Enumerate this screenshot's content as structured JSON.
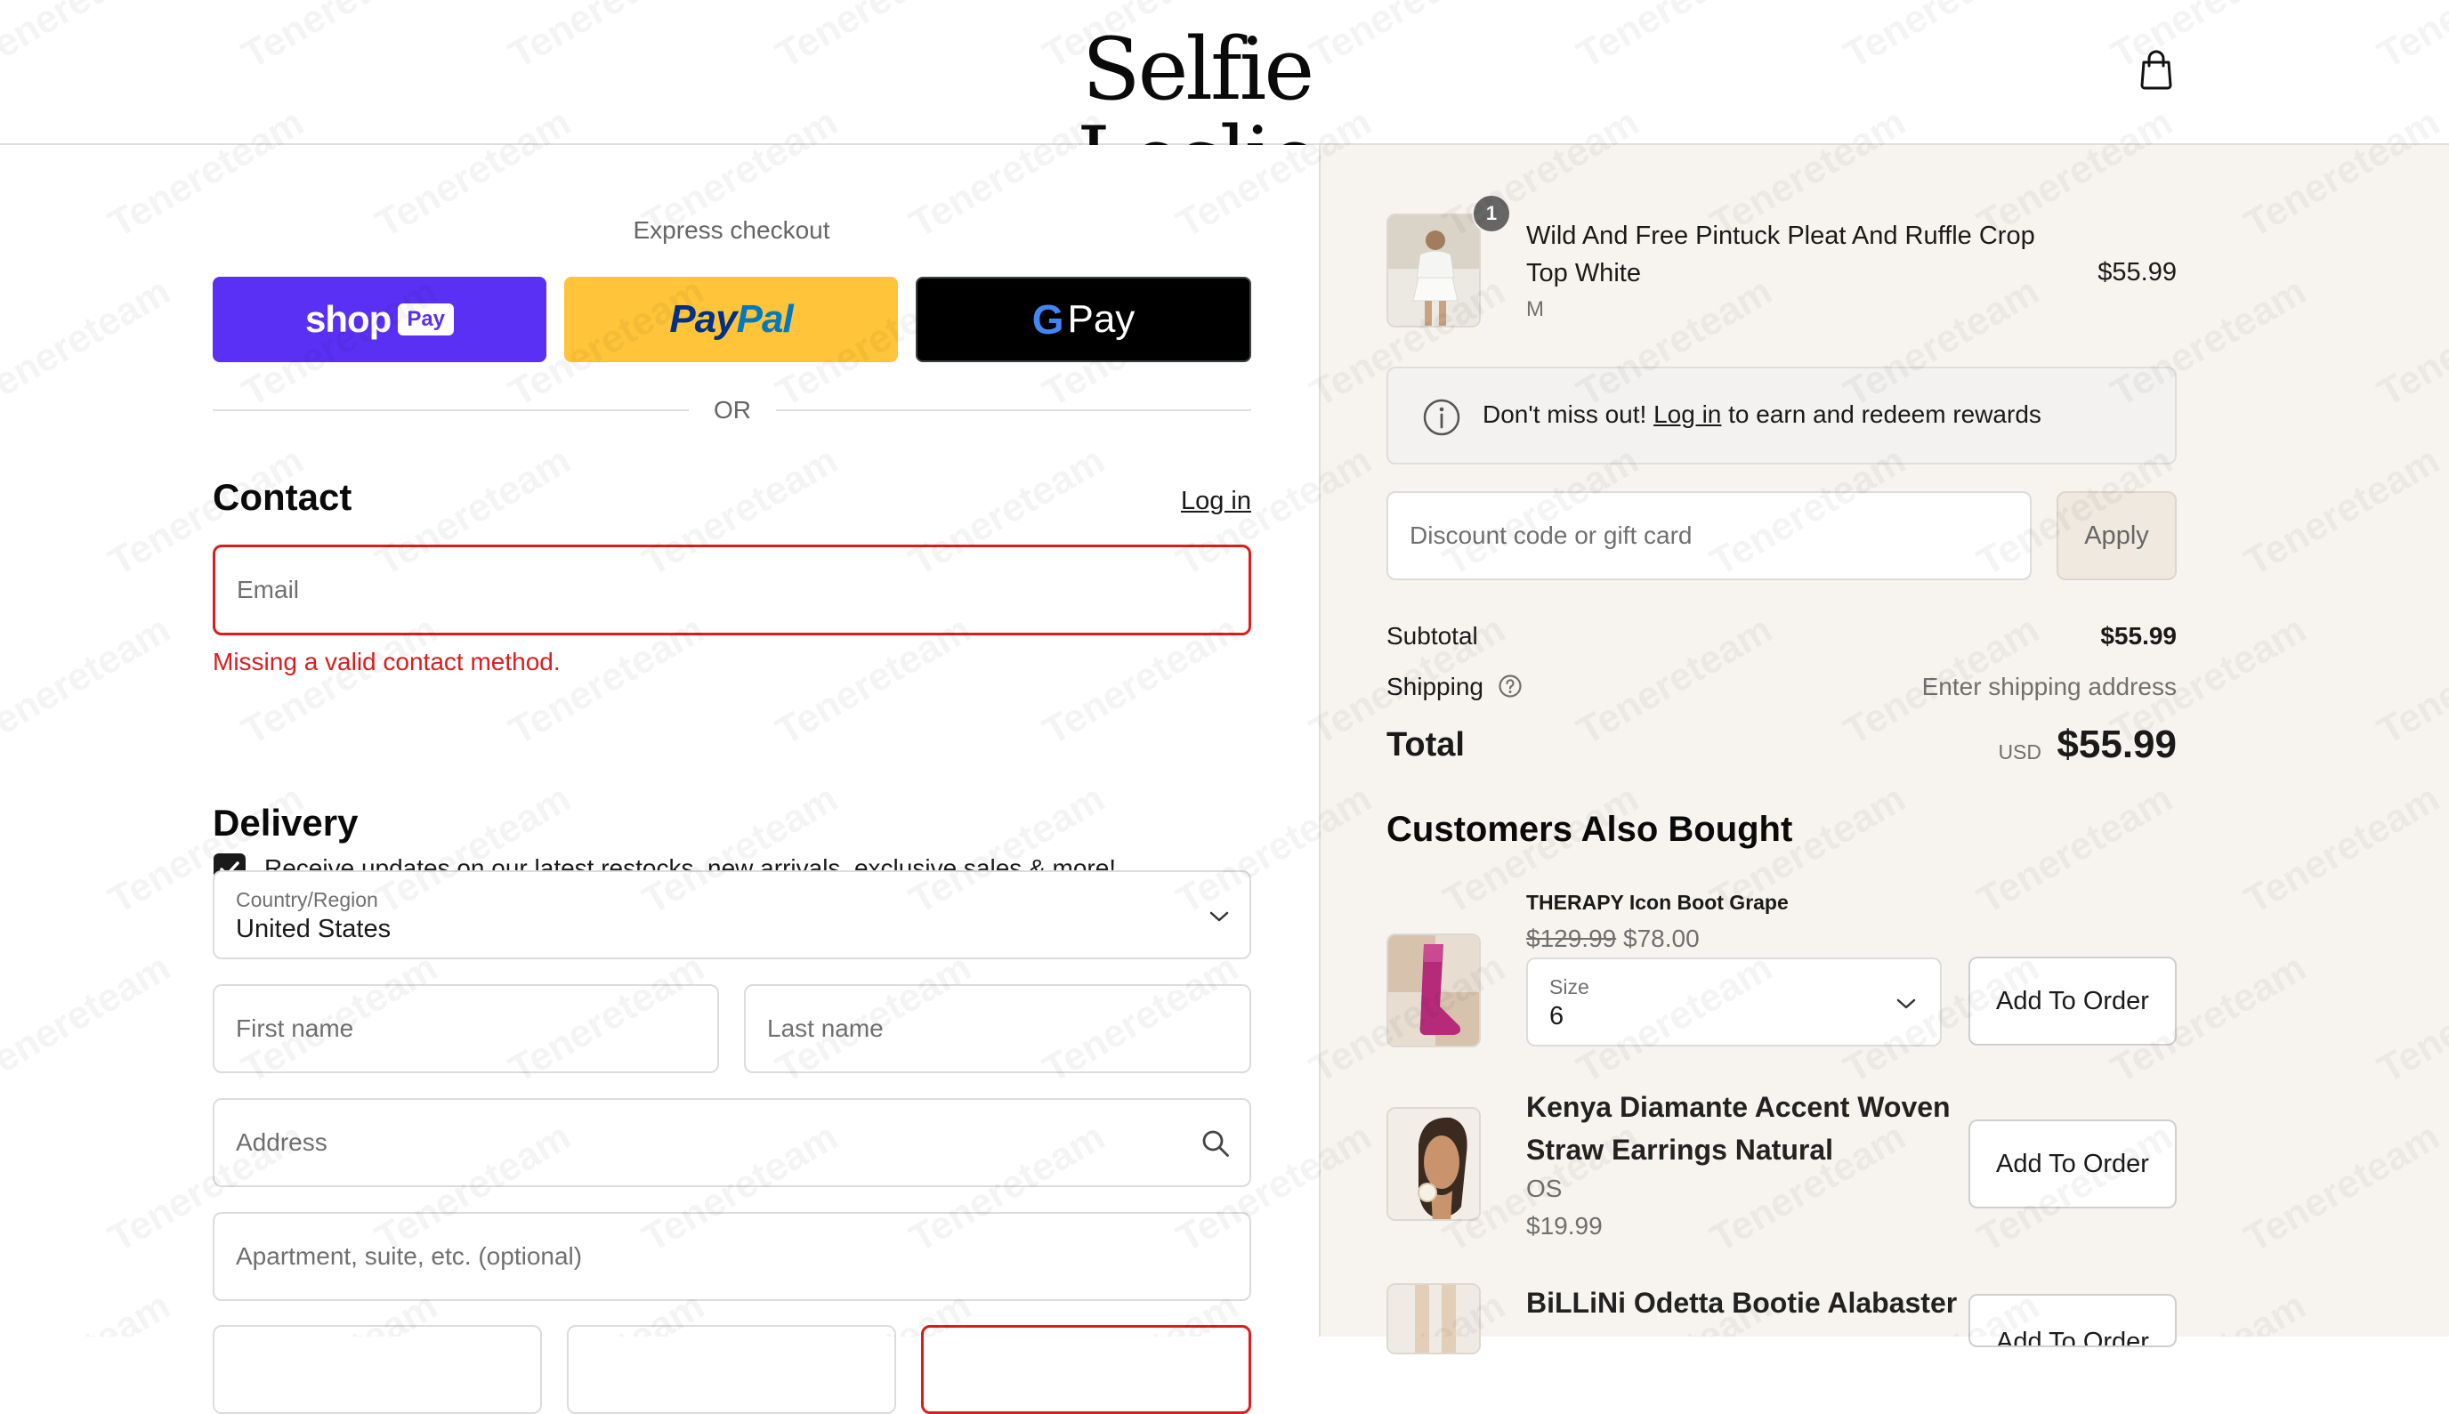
{
  "header": {
    "brand": "Selfie Leslie",
    "cart_icon": "shopping-bag-icon"
  },
  "checkout": {
    "express_title": "Express checkout",
    "shop_pay": {
      "word": "shop",
      "badge": "Pay",
      "color": "#5a31f4"
    },
    "paypal": {
      "pay": "Pay",
      "pal": "Pal",
      "color": "#ffc439"
    },
    "gpay": {
      "g": "G",
      "word": "Pay"
    },
    "or_label": "OR",
    "contact": {
      "title": "Contact",
      "login_label": "Log in",
      "email_placeholder": "Email",
      "error": "Missing a valid contact method.",
      "newsletter_checked": true,
      "newsletter_label": "Receive updates on our latest restocks, new arrivals, exclusive sales & more!"
    },
    "delivery": {
      "title": "Delivery",
      "country_label": "Country/Region",
      "country_value": "United States",
      "first_name_placeholder": "First name",
      "last_name_placeholder": "Last name",
      "address_placeholder": "Address",
      "apartment_placeholder": "Apartment, suite, etc. (optional)"
    }
  },
  "order": {
    "item": {
      "quantity": "1",
      "name_line1": "Wild And Free Pintuck Pleat And Ruffle Crop",
      "name_line2": "Top White",
      "variant": "M",
      "price": "$55.99"
    },
    "rewards": {
      "prefix": "Don't miss out! ",
      "link": "Log in",
      "suffix": " to earn and redeem rewards"
    },
    "discount": {
      "placeholder": "Discount code or gift card",
      "apply_label": "Apply"
    },
    "summary": {
      "subtotal_label": "Subtotal",
      "subtotal_value": "$55.99",
      "shipping_label": "Shipping",
      "shipping_value": "Enter shipping address",
      "total_label": "Total",
      "currency": "USD",
      "total_value": "$55.99"
    }
  },
  "upsell": {
    "title": "Customers Also Bought",
    "add_label": "Add To Order",
    "items": [
      {
        "name": "THERAPY Icon Boot Grape",
        "original_price": "$129.99",
        "sale_price": "$78.00",
        "size_label": "Size",
        "size_value": "6"
      },
      {
        "name_line1": "Kenya Diamante Accent Woven",
        "name_line2": "Straw Earrings Natural",
        "variant": "OS",
        "price": "$19.99"
      },
      {
        "name": "BiLLiNi Odetta Bootie Alabaster"
      }
    ]
  },
  "watermark_text": "Tenereteam",
  "colors": {
    "error": "#dd1d1d",
    "right_panel_bg": "#f7f4ef",
    "shop_pay": "#5a31f4",
    "paypal": "#ffc439"
  }
}
